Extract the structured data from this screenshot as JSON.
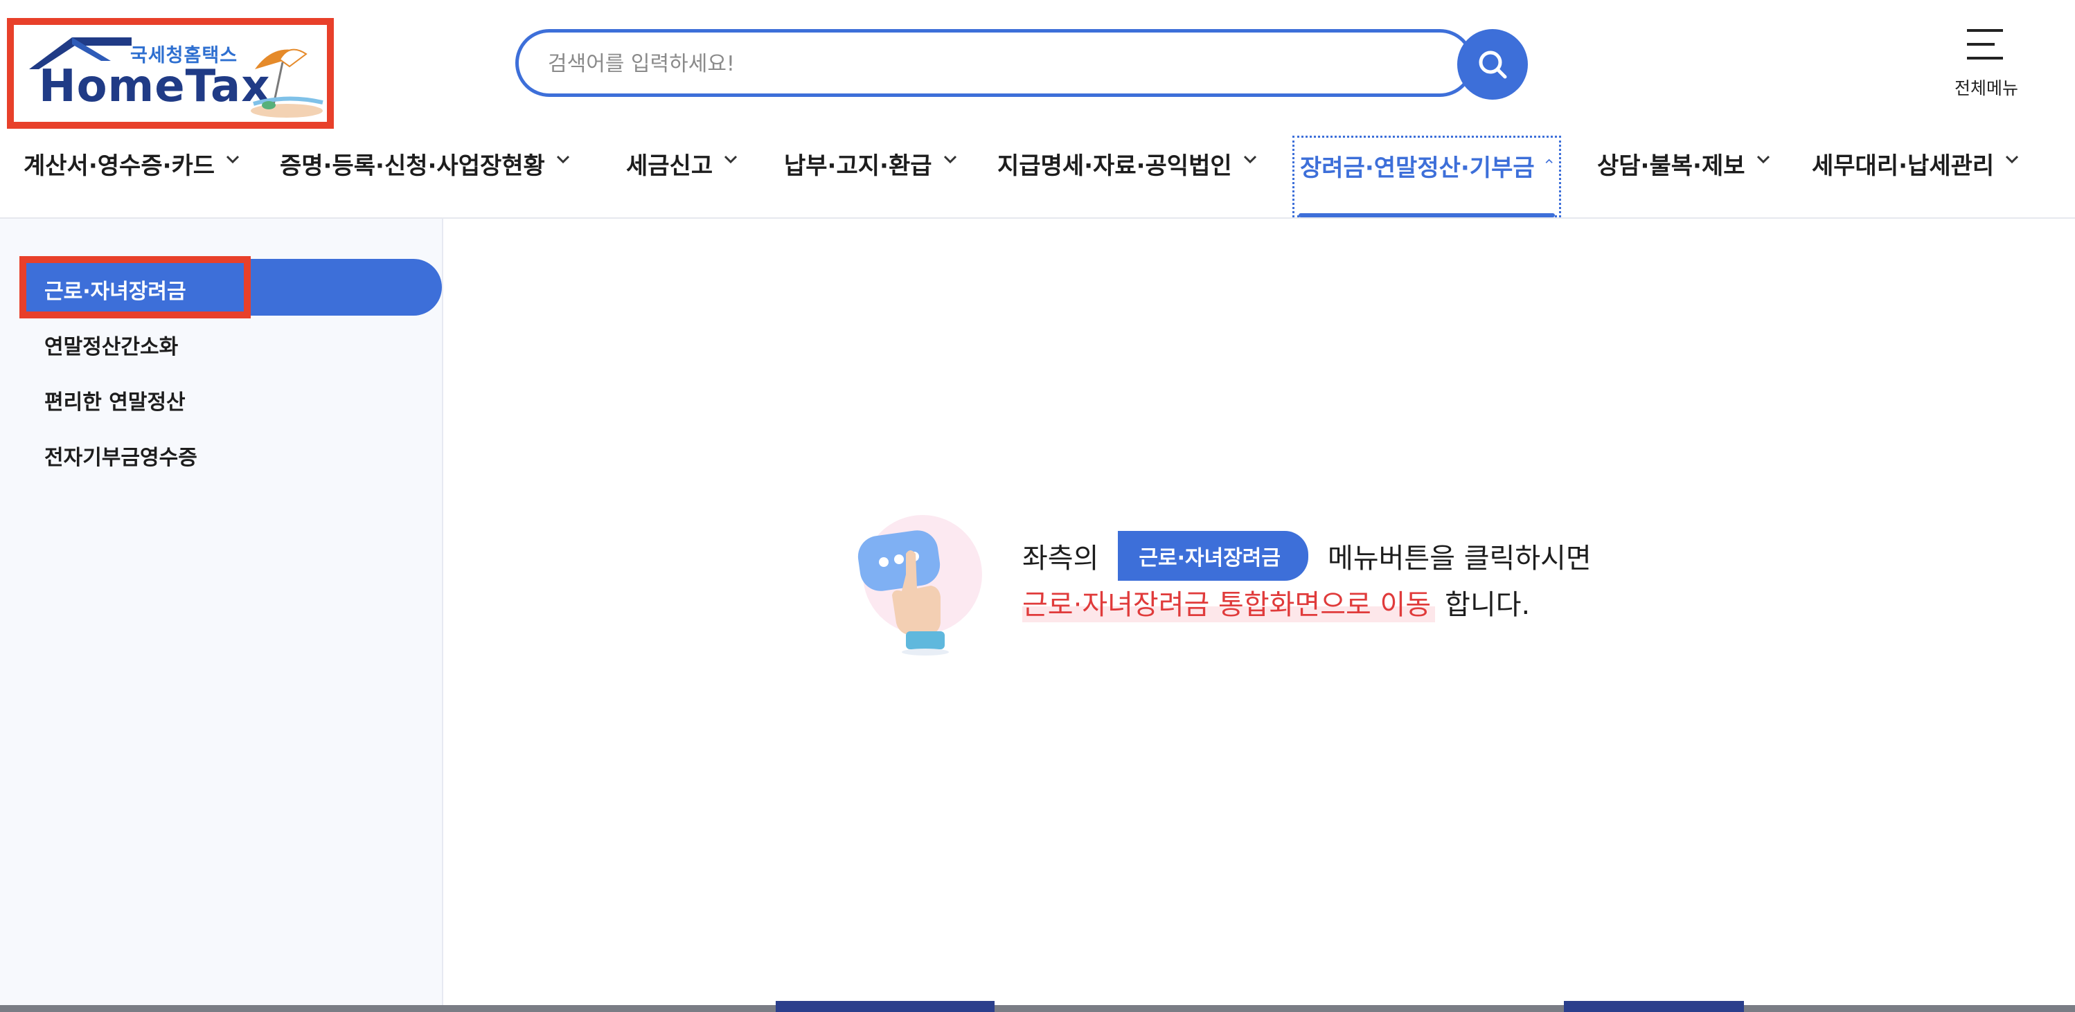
{
  "header": {
    "logo_sub": "국세청홈택스",
    "logo_main": "HomeTax",
    "search_placeholder": "검색어를 입력하세요!",
    "allmenu_label": "전체메뉴"
  },
  "gnb": {
    "items": [
      {
        "label": "계산서·영수증·카드"
      },
      {
        "label": "증명·등록·신청·사업장현황"
      },
      {
        "label": "세금신고"
      },
      {
        "label": "납부·고지·환급"
      },
      {
        "label": "지급명세·자료·공익법인"
      },
      {
        "label": "장려금·연말정산·기부금"
      },
      {
        "label": "상담·불복·제보"
      },
      {
        "label": "세무대리·납세관리"
      }
    ],
    "active_index": 5
  },
  "sidebar": {
    "items": [
      {
        "label": "근로·자녀장려금"
      },
      {
        "label": "연말정산간소화"
      },
      {
        "label": "편리한 연말정산"
      },
      {
        "label": "전자기부금영수증"
      }
    ],
    "active_index": 0
  },
  "guide": {
    "prefix": "좌측의",
    "badge": "근로·자녀장려금",
    "suffix": "메뉴버튼을 클릭하시면",
    "highlight": "근로·자녀장려금 통합화면으로 이동",
    "tail": "합니다."
  },
  "colors": {
    "brand": "#3d6fd9",
    "highlight_red": "#e03b3b",
    "annotation_red": "#e8402a",
    "logo_navy": "#203b86"
  }
}
